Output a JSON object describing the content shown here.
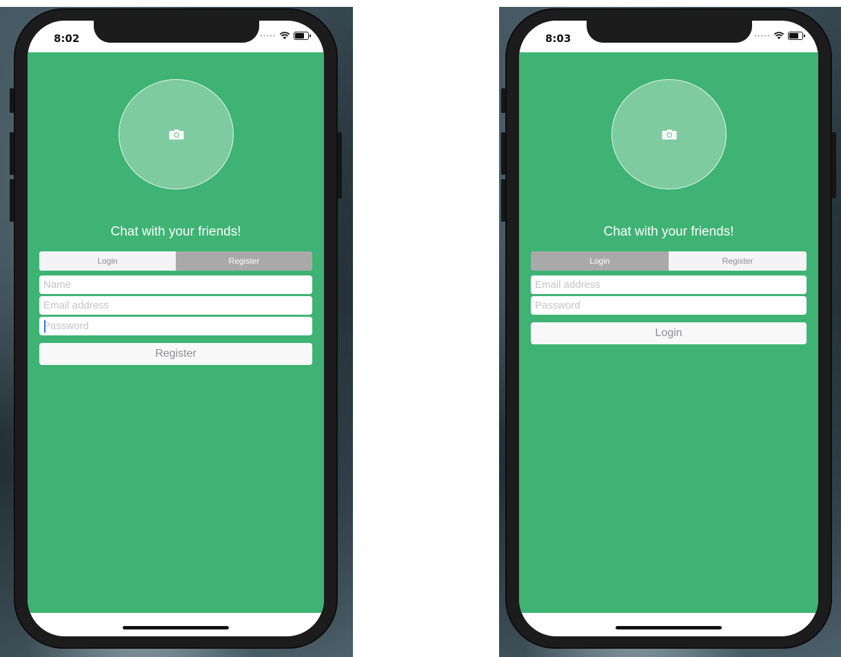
{
  "screens": [
    {
      "time": "8:02",
      "tagline": "Chat with your friends!",
      "segments": [
        "Login",
        "Register"
      ],
      "selected_segment": "Register",
      "fields": {
        "name_placeholder": "Name",
        "email_placeholder": "Email address",
        "password_placeholder": "Password"
      },
      "submit_label": "Register"
    },
    {
      "time": "8:03",
      "tagline": "Chat with your friends!",
      "segments": [
        "Login",
        "Register"
      ],
      "selected_segment": "Login",
      "fields": {
        "email_placeholder": "Email address",
        "password_placeholder": "Password"
      },
      "submit_label": "Login"
    }
  ],
  "colors": {
    "app_background": "#3eb374",
    "avatar_fill": "#7dcb9f",
    "segment_selected": "#a9a9a9",
    "segment_unselected": "#f4f4f6",
    "input_background": "#ffffff",
    "caret": "#2f6df5"
  },
  "icons": {
    "avatar": "camera-icon",
    "wifi": "wifi-icon",
    "battery": "battery-icon"
  }
}
